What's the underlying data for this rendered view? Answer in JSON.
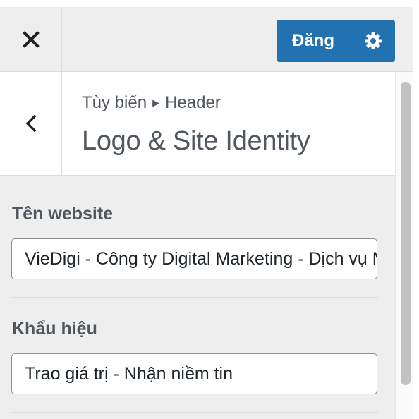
{
  "top_bar": {
    "close_icon": "close-icon",
    "publish_label": "Đăng",
    "settings_icon": "gear-icon"
  },
  "section": {
    "back_icon": "chevron-left-icon",
    "breadcrumb": {
      "parent": "Tùy biến",
      "separator_icon": "triangle-right-icon",
      "current": "Header"
    },
    "title": "Logo & Site Identity"
  },
  "fields": {
    "site_title": {
      "label": "Tên website",
      "value": "VieDigi - Công ty Digital Marketing - Dịch vụ Marketing"
    },
    "tagline": {
      "label": "Khẩu hiệu",
      "value": "Trao giá trị - Nhận niềm tin"
    }
  },
  "colors": {
    "accent": "#2271b1",
    "panel_bg": "#eeeeee",
    "text": "#50575e"
  }
}
